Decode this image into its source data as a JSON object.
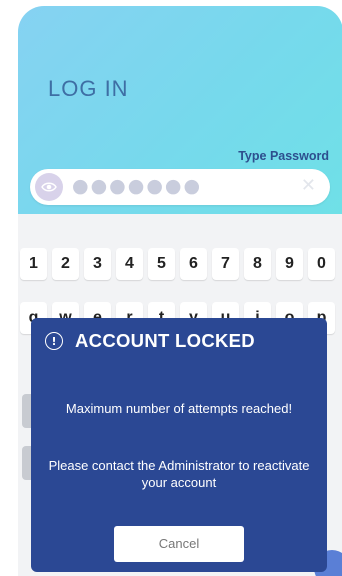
{
  "login": {
    "title": "LOG IN",
    "password_label": "Type Password",
    "password_masked": "●●●●●●●",
    "clear_icon": "close-icon",
    "eye_icon": "eye-icon"
  },
  "keyboard": {
    "row1": [
      "1",
      "2",
      "3",
      "4",
      "5",
      "6",
      "7",
      "8",
      "9",
      "0"
    ],
    "row2": [
      "q",
      "w",
      "e",
      "r",
      "t",
      "y",
      "u",
      "i",
      "o",
      "p"
    ]
  },
  "modal": {
    "icon": "warning-icon",
    "title": "ACCOUNT LOCKED",
    "message1": "Maximum number of attempts reached!",
    "message2": "Please contact the Administrator to reactivate your account",
    "cancel_label": "Cancel"
  },
  "colors": {
    "hero_start": "#86d2f2",
    "hero_end": "#6fe0e7",
    "modal_bg": "#2b4894",
    "title_color": "#3e6ea4"
  }
}
